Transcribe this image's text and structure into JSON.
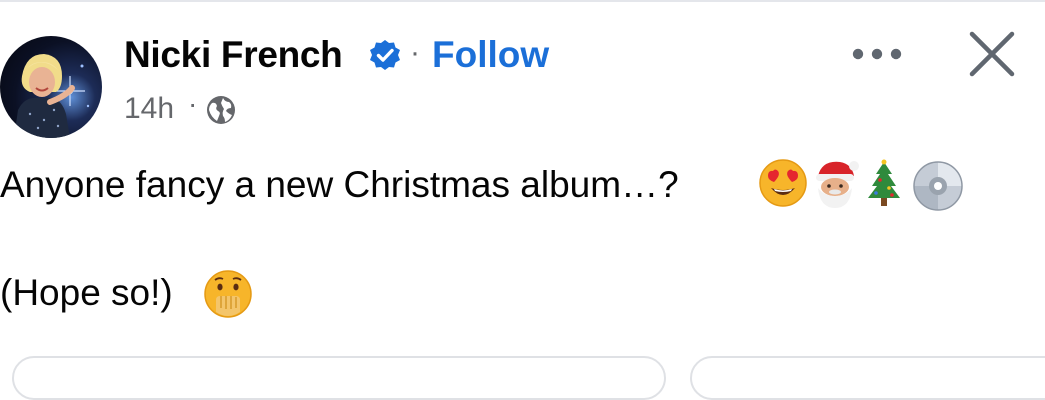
{
  "post": {
    "author": "Nicki French",
    "follow_label": "Follow",
    "separator": "·",
    "timestamp": "14h",
    "text_line1": "Anyone fancy a new Christmas album…?",
    "text_line2": "(Hope so!)"
  },
  "icons": {
    "verified": "verified-badge-icon",
    "privacy": "globe-icon",
    "more": "more-options-icon",
    "close": "close-icon",
    "emoji_line1": [
      "heart-eyes-emoji",
      "santa-emoji",
      "christmas-tree-emoji",
      "dvd-emoji"
    ],
    "emoji_line2": [
      "hand-over-mouth-emoji"
    ]
  },
  "colors": {
    "follow_blue": "#1b6fd8",
    "meta_gray": "#65676b",
    "text": "#050505"
  }
}
